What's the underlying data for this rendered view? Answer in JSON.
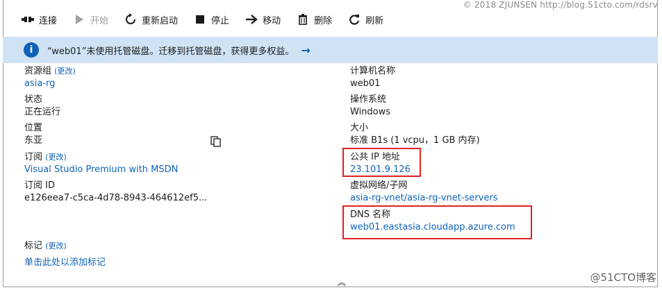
{
  "watermark": {
    "top": "© 2018 ZJUNSEN http://blog.51cto.com/rdsrv",
    "bottom": "@51CTO博客"
  },
  "toolbar": {
    "connect": "连接",
    "start": "开始",
    "restart": "重新启动",
    "stop": "停止",
    "move": "移动",
    "delete": "删除",
    "refresh": "刷新"
  },
  "banner": {
    "message": "“web01”未使用托管磁盘。迁移到托管磁盘，获得更多权益。"
  },
  "left": {
    "resource_group": {
      "label": "资源组",
      "change": "(更改)",
      "value": "asia-rg"
    },
    "status": {
      "label": "状态",
      "value": "正在运行"
    },
    "location": {
      "label": "位置",
      "value": "东亚"
    },
    "subscription": {
      "label": "订阅",
      "change": "(更改)",
      "value": "Visual Studio Premium with MSDN"
    },
    "subscription_id": {
      "label": "订阅 ID",
      "value": "e126eea7-c5ca-4d78-8943-464612ef5..."
    },
    "tags": {
      "label": "标记",
      "change": "(更改)",
      "add": "单击此处以添加标记"
    }
  },
  "right": {
    "computer_name": {
      "label": "计算机名称",
      "value": "web01"
    },
    "os": {
      "label": "操作系统",
      "value": "Windows"
    },
    "size": {
      "label": "大小",
      "value": "标准 B1s (1 vcpu，1 GB 内存)"
    },
    "public_ip": {
      "label": "公共 IP 地址",
      "value": "23.101.9.126"
    },
    "vnet": {
      "label": "虚拟网络/子网",
      "value": "asia-rg-vnet/asia-rg-vnet-servers"
    },
    "dns": {
      "label": "DNS 名称",
      "value": "web01.eastasia.cloudapp.azure.com"
    }
  },
  "colors": {
    "accent": "#0f62b8",
    "banner_bg": "#cfe3f5",
    "highlight": "#e02020"
  }
}
